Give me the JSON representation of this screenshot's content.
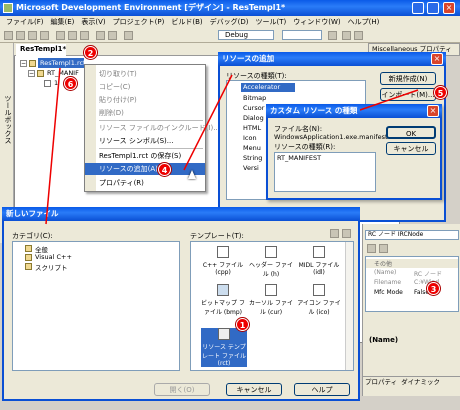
{
  "app": {
    "title": "Microsoft Development Environment [デザイン] - ResTempl1*"
  },
  "menubar": [
    "ファイル(F)",
    "編集(E)",
    "表示(V)",
    "プロジェクト(P)",
    "ビルド(B)",
    "デバッグ(D)",
    "ツール(T)",
    "ウィンドウ(W)",
    "ヘルプ(H)"
  ],
  "toolbar": {
    "config": "Debug"
  },
  "doc": {
    "tab": "ResTempl1*",
    "root": "ResTempl1.rct",
    "child": "RT_MANIF",
    "leaf": "1"
  },
  "side": {
    "toolbox": "ツールボックス"
  },
  "top_right": {
    "label": "Miscellaneous プロパティ"
  },
  "context_menu": {
    "items": [
      "切り取り(T)",
      "コピー(C)",
      "貼り付け(P)",
      "削除(D)",
      "リソース ファイルのインクルード(I)...",
      "リソース シンボル(S)...",
      "ResTempl1.rct の保存(S)",
      "リソースの追加(A)...",
      "プロパティ(R)"
    ]
  },
  "add_resource": {
    "title": "リソースの追加",
    "types_label": "リソースの種類(T):",
    "types": [
      "Accelerator",
      "Bitmap",
      "Cursor",
      "Dialog",
      "HTML",
      "Icon",
      "Menu",
      "String",
      "Versi"
    ],
    "new_button": "新規作成(N)",
    "import_button": "インポート(M)..."
  },
  "custom_type": {
    "title": "カスタム リソース の種類",
    "filename_label": "ファイル名(N):",
    "filename": "WindowsApplication1.exe.manifest",
    "type_label": "リソースの種類(R):",
    "type_value": "RT_MANIFEST",
    "ok": "OK",
    "cancel": "キャンセル"
  },
  "new_file": {
    "title": "新しいファイル",
    "category_label": "カテゴリ(C):",
    "categories": [
      "全般",
      "Visual C++",
      "スクリプト"
    ],
    "template_label": "テンプレート(T):",
    "templates": [
      {
        "label": "C++ ファイル (cpp)"
      },
      {
        "label": "ヘッダー ファイル (h)"
      },
      {
        "label": "MIDL ファイル (idl)"
      },
      {
        "label": "ビットマップ ファイル (bmp)"
      },
      {
        "label": "カーソル ファイル (cur)"
      },
      {
        "label": "アイコン ファイル (ico)"
      },
      {
        "label": "リソース テンプレート ファイル (rct)"
      }
    ],
    "open_button": "開く(O)",
    "cancel_button": "キャンセル",
    "help_button": "ヘルプ"
  },
  "properties": {
    "combo": "RC ノード IRCNode",
    "rows": [
      [
        "その他",
        ""
      ],
      [
        "(Name)",
        "RC ノード"
      ],
      [
        "Filename",
        "C:¥Wind"
      ],
      [
        "Mfc Mode",
        "False"
      ]
    ],
    "name_box": "(Name)",
    "tab1": "プロパティ",
    "tab2": "ダイナミック"
  },
  "badges": {
    "b1": "1",
    "b2": "2",
    "b3": "3",
    "b4": "4",
    "b5": "5",
    "b6": "6"
  }
}
